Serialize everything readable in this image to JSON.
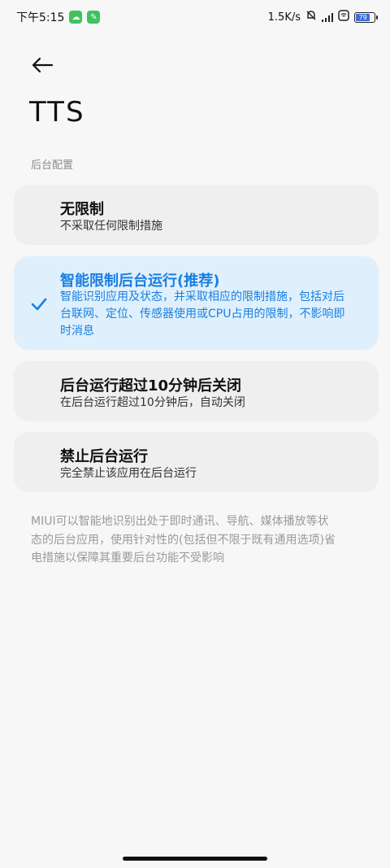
{
  "status_bar": {
    "time": "下午5:15",
    "net_speed": "1.5K/s",
    "battery_level": "79",
    "battery_percent": 79
  },
  "header": {
    "title": "TTS"
  },
  "section": {
    "label": "后台配置"
  },
  "options": [
    {
      "title": "无限制",
      "desc": "不采取任何限制措施",
      "selected": false
    },
    {
      "title": "智能限制后台运行(推荐)",
      "desc": "智能识别应用及状态，并采取相应的限制措施，包括对后台联网、定位、传感器使用或CPU占用的限制，不影响即时消息",
      "selected": true
    },
    {
      "title": "后台运行超过10分钟后关闭",
      "desc": "在后台运行超过10分钟后，自动关闭",
      "selected": false
    },
    {
      "title": "禁止后台运行",
      "desc": "完全禁止该应用在后台运行",
      "selected": false
    }
  ],
  "footnote": "MIUI可以智能地识别出处于即时通讯、导航、媒体播放等状态的后台应用，使用针对性的(包括但不限于既有通用选项)省电措施以保障其重要后台功能不受影响",
  "colors": {
    "accent": "#1a7fe0",
    "selected_bg": "#dff0fc",
    "card_bg": "#efefef"
  }
}
